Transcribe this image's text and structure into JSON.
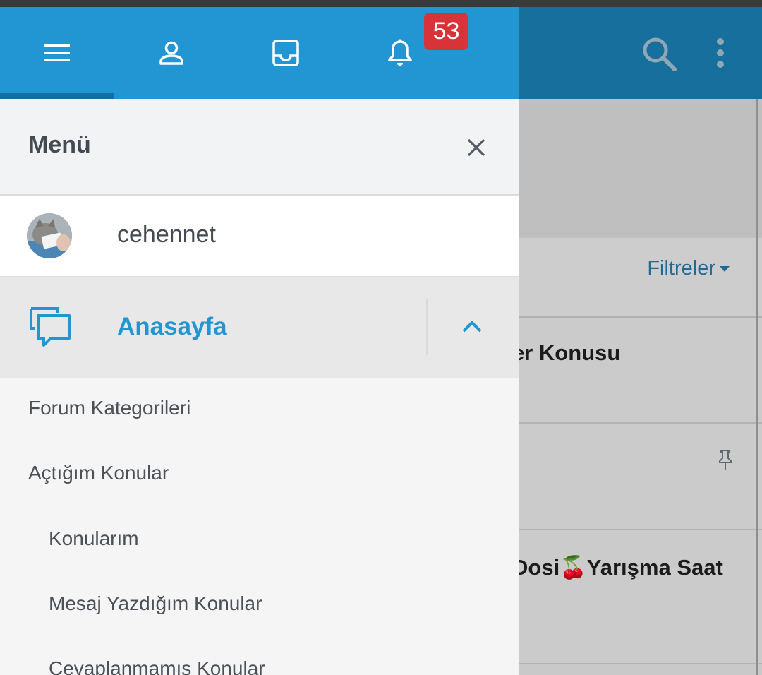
{
  "drawer": {
    "tabs": [
      {
        "icon": "menu-icon"
      },
      {
        "icon": "user-icon"
      },
      {
        "icon": "inbox-icon"
      },
      {
        "icon": "bell-icon"
      }
    ],
    "notification_count": "53",
    "title": "Menü",
    "user": {
      "name": "cehennet"
    },
    "home": {
      "label": "Anasayfa",
      "icon": "chat-bubbles-icon"
    },
    "sub_items": [
      "Forum Kategorileri",
      "Açtığım Konular",
      "Konularım",
      "Mesaj Yazdığım Konular",
      "Cevaplanmamış Konular"
    ]
  },
  "background": {
    "filter_label": "Filtreler",
    "rows": [
      "er Konusu",
      "",
      "Dosi🍒Yarışma Saat"
    ]
  },
  "colors": {
    "accent": "#2196d2",
    "badge": "#d9333a",
    "header_dim": "#166f9c"
  }
}
